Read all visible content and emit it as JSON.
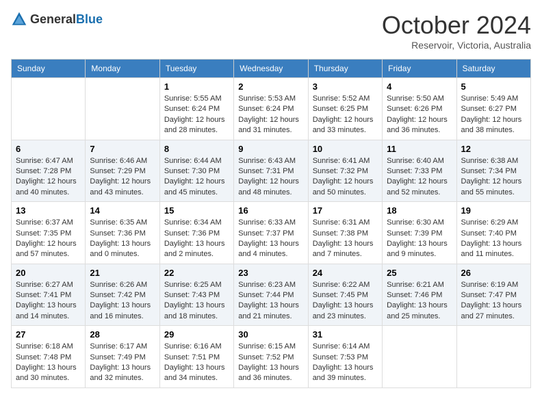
{
  "logo": {
    "text_general": "General",
    "text_blue": "Blue"
  },
  "header": {
    "month": "October 2024",
    "location": "Reservoir, Victoria, Australia"
  },
  "weekdays": [
    "Sunday",
    "Monday",
    "Tuesday",
    "Wednesday",
    "Thursday",
    "Friday",
    "Saturday"
  ],
  "weeks": [
    [
      {
        "day": "",
        "info": ""
      },
      {
        "day": "",
        "info": ""
      },
      {
        "day": "1",
        "info": "Sunrise: 5:55 AM\nSunset: 6:24 PM\nDaylight: 12 hours and 28 minutes."
      },
      {
        "day": "2",
        "info": "Sunrise: 5:53 AM\nSunset: 6:24 PM\nDaylight: 12 hours and 31 minutes."
      },
      {
        "day": "3",
        "info": "Sunrise: 5:52 AM\nSunset: 6:25 PM\nDaylight: 12 hours and 33 minutes."
      },
      {
        "day": "4",
        "info": "Sunrise: 5:50 AM\nSunset: 6:26 PM\nDaylight: 12 hours and 36 minutes."
      },
      {
        "day": "5",
        "info": "Sunrise: 5:49 AM\nSunset: 6:27 PM\nDaylight: 12 hours and 38 minutes."
      }
    ],
    [
      {
        "day": "6",
        "info": "Sunrise: 6:47 AM\nSunset: 7:28 PM\nDaylight: 12 hours and 40 minutes."
      },
      {
        "day": "7",
        "info": "Sunrise: 6:46 AM\nSunset: 7:29 PM\nDaylight: 12 hours and 43 minutes."
      },
      {
        "day": "8",
        "info": "Sunrise: 6:44 AM\nSunset: 7:30 PM\nDaylight: 12 hours and 45 minutes."
      },
      {
        "day": "9",
        "info": "Sunrise: 6:43 AM\nSunset: 7:31 PM\nDaylight: 12 hours and 48 minutes."
      },
      {
        "day": "10",
        "info": "Sunrise: 6:41 AM\nSunset: 7:32 PM\nDaylight: 12 hours and 50 minutes."
      },
      {
        "day": "11",
        "info": "Sunrise: 6:40 AM\nSunset: 7:33 PM\nDaylight: 12 hours and 52 minutes."
      },
      {
        "day": "12",
        "info": "Sunrise: 6:38 AM\nSunset: 7:34 PM\nDaylight: 12 hours and 55 minutes."
      }
    ],
    [
      {
        "day": "13",
        "info": "Sunrise: 6:37 AM\nSunset: 7:35 PM\nDaylight: 12 hours and 57 minutes."
      },
      {
        "day": "14",
        "info": "Sunrise: 6:35 AM\nSunset: 7:36 PM\nDaylight: 13 hours and 0 minutes."
      },
      {
        "day": "15",
        "info": "Sunrise: 6:34 AM\nSunset: 7:36 PM\nDaylight: 13 hours and 2 minutes."
      },
      {
        "day": "16",
        "info": "Sunrise: 6:33 AM\nSunset: 7:37 PM\nDaylight: 13 hours and 4 minutes."
      },
      {
        "day": "17",
        "info": "Sunrise: 6:31 AM\nSunset: 7:38 PM\nDaylight: 13 hours and 7 minutes."
      },
      {
        "day": "18",
        "info": "Sunrise: 6:30 AM\nSunset: 7:39 PM\nDaylight: 13 hours and 9 minutes."
      },
      {
        "day": "19",
        "info": "Sunrise: 6:29 AM\nSunset: 7:40 PM\nDaylight: 13 hours and 11 minutes."
      }
    ],
    [
      {
        "day": "20",
        "info": "Sunrise: 6:27 AM\nSunset: 7:41 PM\nDaylight: 13 hours and 14 minutes."
      },
      {
        "day": "21",
        "info": "Sunrise: 6:26 AM\nSunset: 7:42 PM\nDaylight: 13 hours and 16 minutes."
      },
      {
        "day": "22",
        "info": "Sunrise: 6:25 AM\nSunset: 7:43 PM\nDaylight: 13 hours and 18 minutes."
      },
      {
        "day": "23",
        "info": "Sunrise: 6:23 AM\nSunset: 7:44 PM\nDaylight: 13 hours and 21 minutes."
      },
      {
        "day": "24",
        "info": "Sunrise: 6:22 AM\nSunset: 7:45 PM\nDaylight: 13 hours and 23 minutes."
      },
      {
        "day": "25",
        "info": "Sunrise: 6:21 AM\nSunset: 7:46 PM\nDaylight: 13 hours and 25 minutes."
      },
      {
        "day": "26",
        "info": "Sunrise: 6:19 AM\nSunset: 7:47 PM\nDaylight: 13 hours and 27 minutes."
      }
    ],
    [
      {
        "day": "27",
        "info": "Sunrise: 6:18 AM\nSunset: 7:48 PM\nDaylight: 13 hours and 30 minutes."
      },
      {
        "day": "28",
        "info": "Sunrise: 6:17 AM\nSunset: 7:49 PM\nDaylight: 13 hours and 32 minutes."
      },
      {
        "day": "29",
        "info": "Sunrise: 6:16 AM\nSunset: 7:51 PM\nDaylight: 13 hours and 34 minutes."
      },
      {
        "day": "30",
        "info": "Sunrise: 6:15 AM\nSunset: 7:52 PM\nDaylight: 13 hours and 36 minutes."
      },
      {
        "day": "31",
        "info": "Sunrise: 6:14 AM\nSunset: 7:53 PM\nDaylight: 13 hours and 39 minutes."
      },
      {
        "day": "",
        "info": ""
      },
      {
        "day": "",
        "info": ""
      }
    ]
  ]
}
